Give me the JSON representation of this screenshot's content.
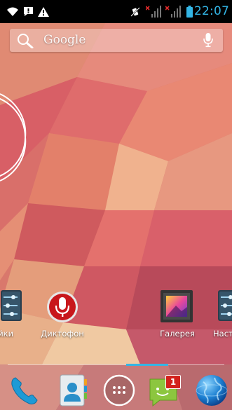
{
  "status_bar": {
    "time": "22:07",
    "icons": [
      "wifi-icon",
      "notification-icon",
      "warning-icon",
      "vibrate-mute-icon",
      "signal-1-icon",
      "signal-2-icon",
      "battery-icon"
    ],
    "time_color": "#33b5e5"
  },
  "search": {
    "label": "Google",
    "icons": [
      "search-icon",
      "mic-icon"
    ]
  },
  "home": {
    "apps": [
      {
        "label": "ройки",
        "icon": "settings-icon"
      },
      {
        "label": "Диктофон",
        "icon": "voice-recorder-icon"
      },
      {
        "label": "Галерея",
        "icon": "gallery-icon"
      },
      {
        "label": "Наст",
        "icon": "settings-icon"
      }
    ]
  },
  "dock": {
    "items": [
      {
        "name": "phone",
        "icon": "phone-icon"
      },
      {
        "name": "contacts",
        "icon": "contacts-icon"
      },
      {
        "name": "all-apps",
        "icon": "app-drawer-icon"
      },
      {
        "name": "messaging",
        "icon": "messaging-icon",
        "badge": "1"
      },
      {
        "name": "browser",
        "icon": "globe-icon"
      }
    ]
  },
  "colors": {
    "accent": "#33b5e5",
    "wallpaper_base": "#d87a6e"
  }
}
